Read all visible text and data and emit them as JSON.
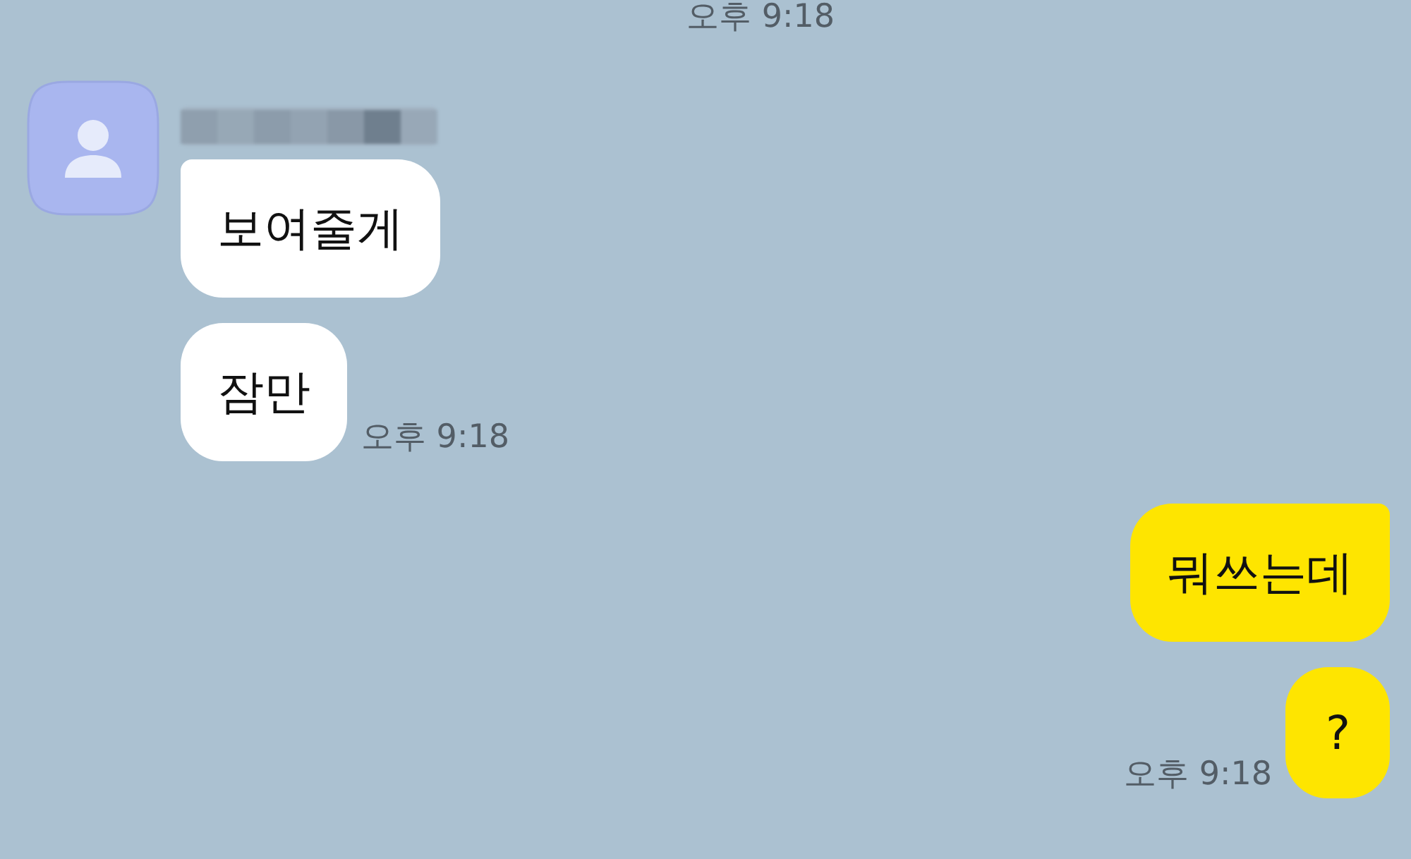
{
  "top_time": "오후 9:18",
  "groups": [
    {
      "kind": "received",
      "messages": [
        {
          "text": "보여줄게",
          "first": true
        },
        {
          "text": "잠만",
          "first": false,
          "time": "오후 9:18"
        }
      ]
    },
    {
      "kind": "sent",
      "messages": [
        {
          "text": "뭐쓰는데",
          "first": true
        },
        {
          "text": "?",
          "first": false,
          "time": "오후 9:18"
        }
      ]
    }
  ]
}
